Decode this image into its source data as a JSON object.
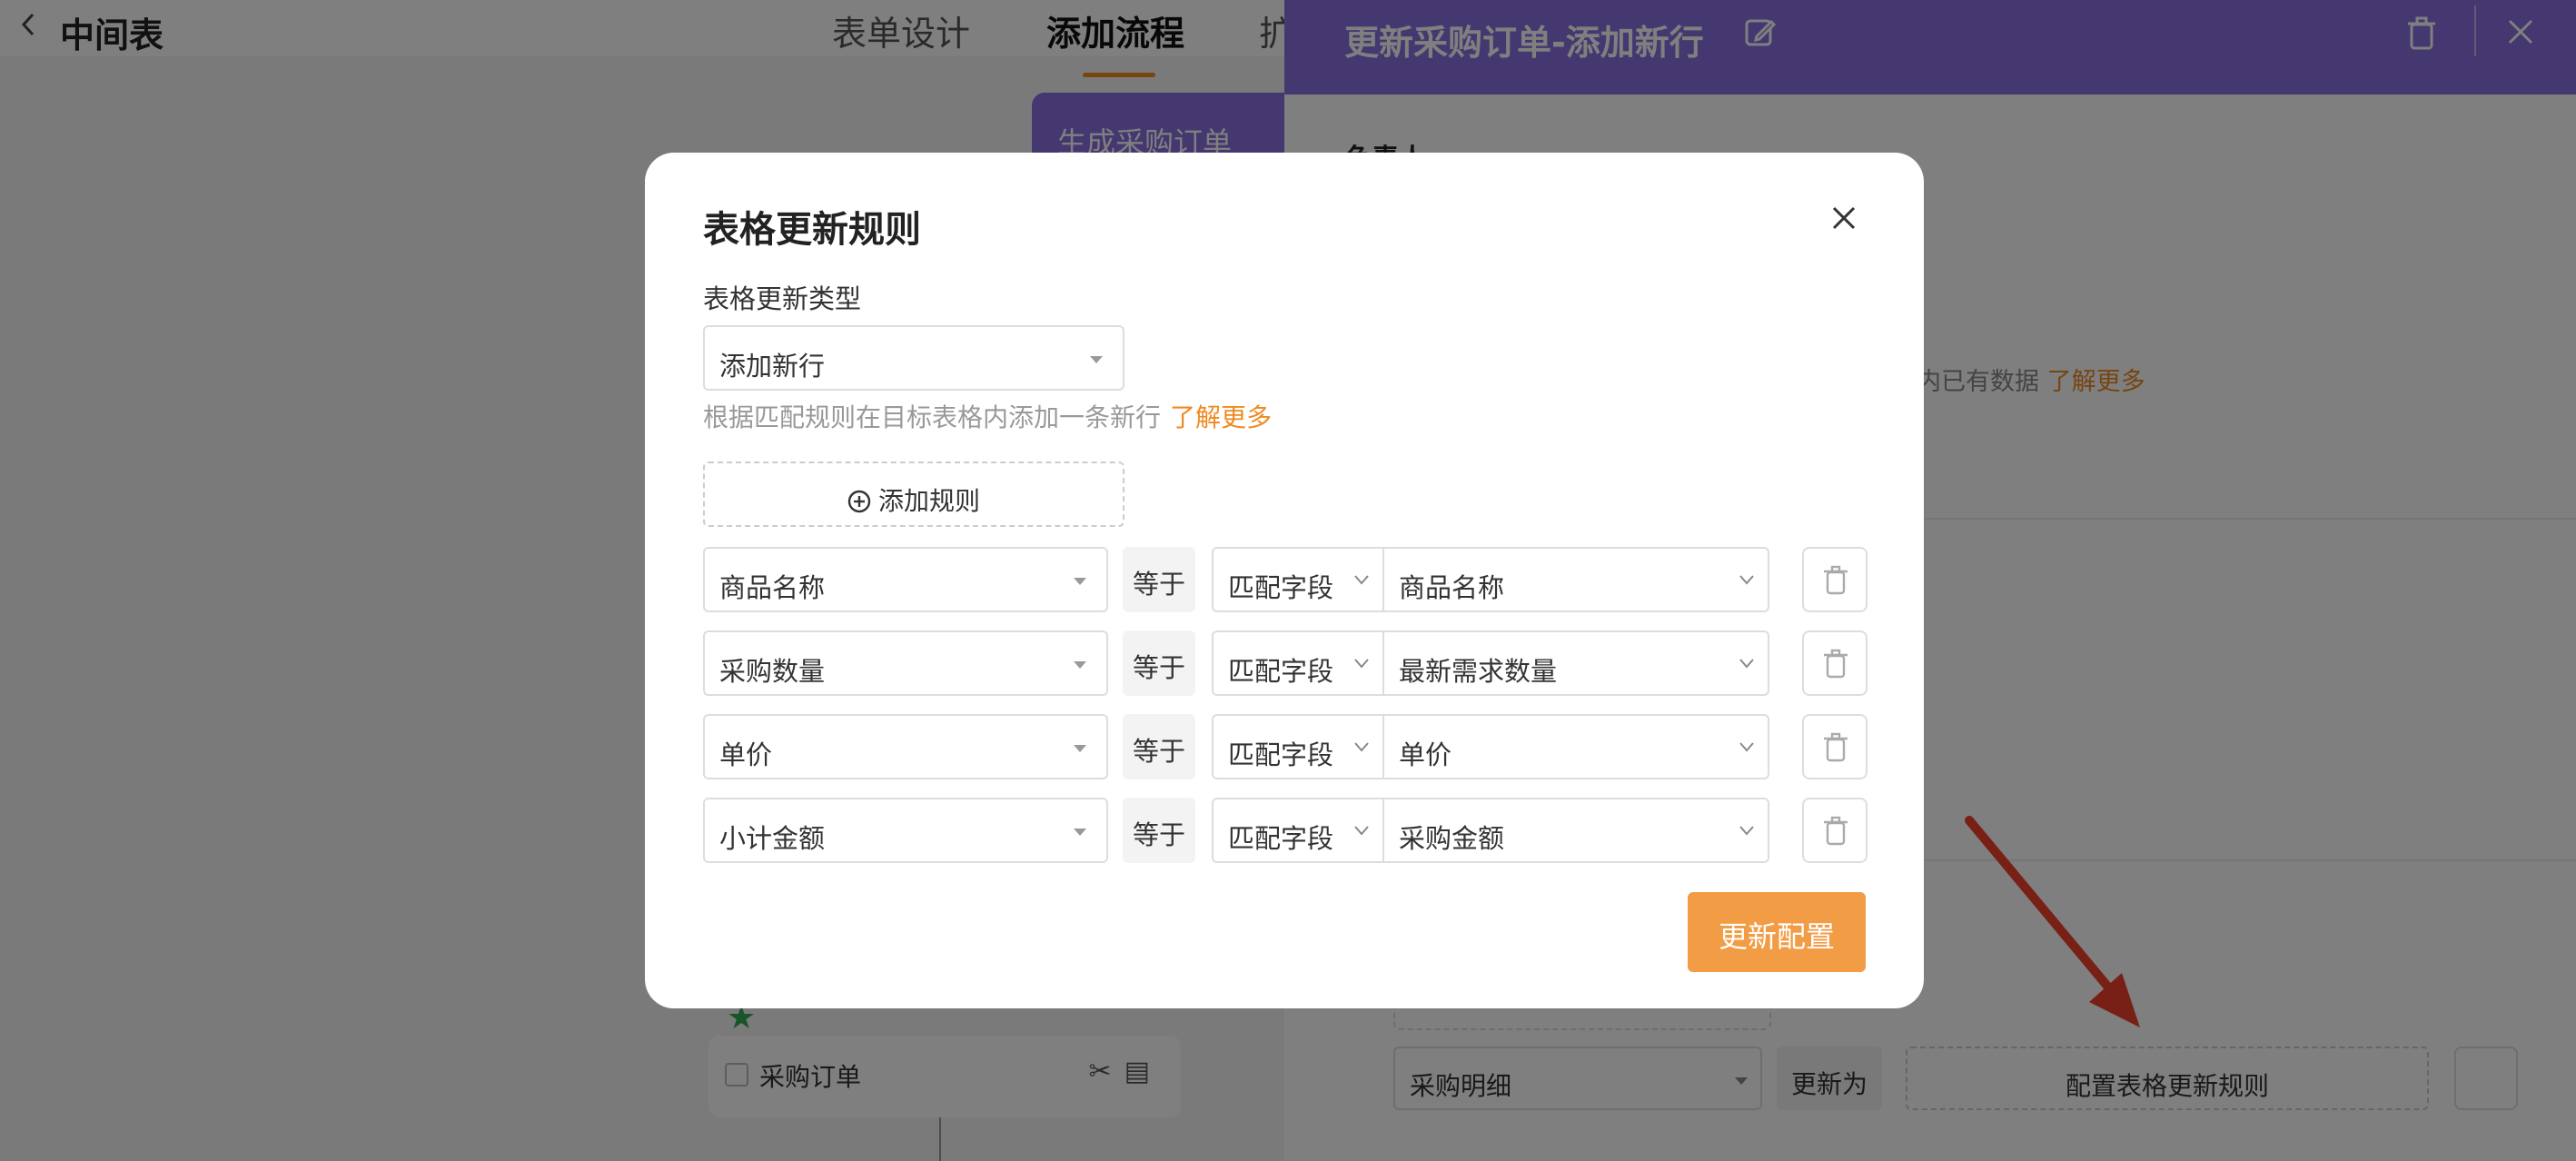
{
  "app": {
    "title": "中间表",
    "tabs": [
      "表单设计",
      "添加流程",
      "扩"
    ],
    "flow_card_label": "生成采购订单",
    "flow_list_item": "采购订单"
  },
  "panel": {
    "title": "更新采购订单-添加新行",
    "owner_label": "负责人",
    "description": "内已有数据",
    "learn_more": "了解更多",
    "table_select": "采购明细",
    "update_as": "更新为",
    "config_rule_button": "配置表格更新规则"
  },
  "modal": {
    "title": "表格更新规则",
    "type_label": "表格更新类型",
    "type_value": "添加新行",
    "hint": "根据匹配规则在目标表格内添加一条新行",
    "hint_link": "了解更多",
    "add_rule": "添加规则",
    "submit": "更新配置",
    "rules": [
      {
        "left": "商品名称",
        "op": "等于",
        "mode": "匹配字段",
        "right": "商品名称"
      },
      {
        "left": "采购数量",
        "op": "等于",
        "mode": "匹配字段",
        "right": "最新需求数量"
      },
      {
        "left": "单价",
        "op": "等于",
        "mode": "匹配字段",
        "right": "单价"
      },
      {
        "left": "小计金额",
        "op": "等于",
        "mode": "匹配字段",
        "right": "采购金额"
      }
    ]
  },
  "colors": {
    "accent": "#ef8a22",
    "panel_header": "#8b6ee0",
    "primary_button": "#f29c45",
    "annotation_arrow": "#f0412a"
  }
}
